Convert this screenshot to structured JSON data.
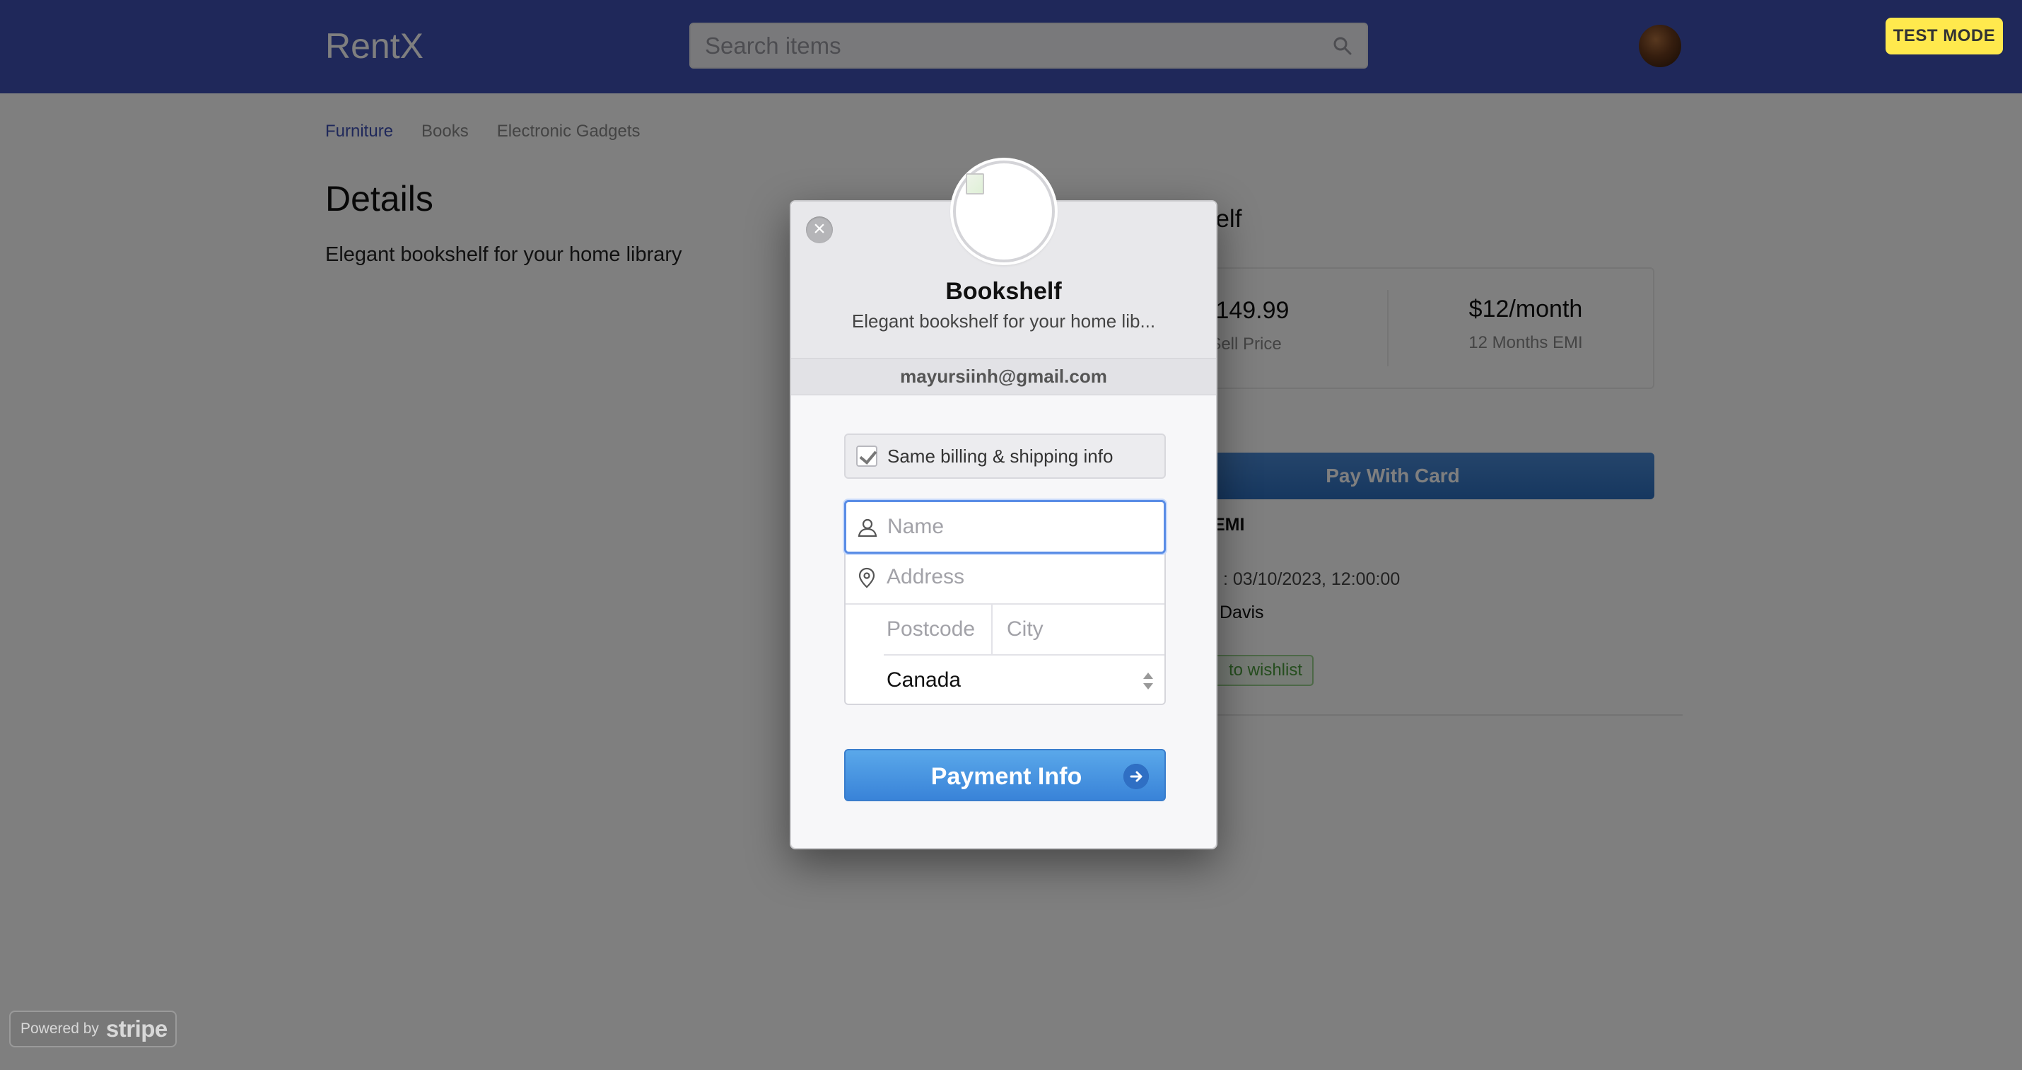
{
  "header": {
    "brand": "RentX",
    "search_placeholder": "Search items",
    "test_mode": "TEST MODE"
  },
  "categories": [
    {
      "label": "Furniture",
      "active": true
    },
    {
      "label": "Books",
      "active": false
    },
    {
      "label": "Electronic Gadgets",
      "active": false
    }
  ],
  "details": {
    "title": "Details",
    "description": "Elegant bookshelf for your home library"
  },
  "product": {
    "title_visible": "helf",
    "sell_price": "$149.99",
    "sell_price_label": "Sell Price",
    "emi_price": "$12/month",
    "emi_label": "12 Months EMI",
    "pay_with_card": "Pay With Card",
    "emi_heading": "EMI",
    "date_visible": ": 03/10/2023, 12:00:00",
    "owner_visible": "Davis",
    "wishlist_visible": "to wishlist"
  },
  "checkout": {
    "title": "Bookshelf",
    "subtitle": "Elegant bookshelf for your home lib...",
    "email": "mayursiinh@gmail.com",
    "same_billing_label": "Same billing & shipping info",
    "same_billing_checked": true,
    "name_placeholder": "Name",
    "address_placeholder": "Address",
    "postcode_placeholder": "Postcode",
    "city_placeholder": "City",
    "country": "Canada",
    "submit_label": "Payment Info",
    "close_glyph": "×"
  },
  "footer": {
    "powered_by": "Powered by",
    "stripe": "stripe"
  },
  "colors": {
    "navbar": "#3f51b5",
    "test_mode_bg": "#ffe94d",
    "primary_button": "#3983d8",
    "focus_ring": "#5a8de6",
    "wishlist_green": "#4b9a3c"
  }
}
